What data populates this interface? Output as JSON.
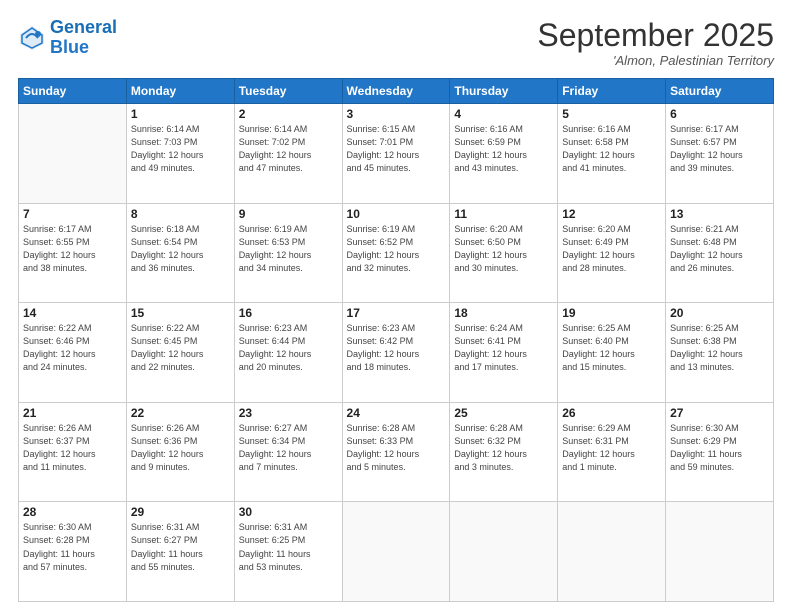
{
  "logo": {
    "line1": "General",
    "line2": "Blue"
  },
  "header": {
    "month": "September 2025",
    "location": "'Almon, Palestinian Territory"
  },
  "weekdays": [
    "Sunday",
    "Monday",
    "Tuesday",
    "Wednesday",
    "Thursday",
    "Friday",
    "Saturday"
  ],
  "weeks": [
    [
      {
        "day": "",
        "info": ""
      },
      {
        "day": "1",
        "info": "Sunrise: 6:14 AM\nSunset: 7:03 PM\nDaylight: 12 hours\nand 49 minutes."
      },
      {
        "day": "2",
        "info": "Sunrise: 6:14 AM\nSunset: 7:02 PM\nDaylight: 12 hours\nand 47 minutes."
      },
      {
        "day": "3",
        "info": "Sunrise: 6:15 AM\nSunset: 7:01 PM\nDaylight: 12 hours\nand 45 minutes."
      },
      {
        "day": "4",
        "info": "Sunrise: 6:16 AM\nSunset: 6:59 PM\nDaylight: 12 hours\nand 43 minutes."
      },
      {
        "day": "5",
        "info": "Sunrise: 6:16 AM\nSunset: 6:58 PM\nDaylight: 12 hours\nand 41 minutes."
      },
      {
        "day": "6",
        "info": "Sunrise: 6:17 AM\nSunset: 6:57 PM\nDaylight: 12 hours\nand 39 minutes."
      }
    ],
    [
      {
        "day": "7",
        "info": "Sunrise: 6:17 AM\nSunset: 6:55 PM\nDaylight: 12 hours\nand 38 minutes."
      },
      {
        "day": "8",
        "info": "Sunrise: 6:18 AM\nSunset: 6:54 PM\nDaylight: 12 hours\nand 36 minutes."
      },
      {
        "day": "9",
        "info": "Sunrise: 6:19 AM\nSunset: 6:53 PM\nDaylight: 12 hours\nand 34 minutes."
      },
      {
        "day": "10",
        "info": "Sunrise: 6:19 AM\nSunset: 6:52 PM\nDaylight: 12 hours\nand 32 minutes."
      },
      {
        "day": "11",
        "info": "Sunrise: 6:20 AM\nSunset: 6:50 PM\nDaylight: 12 hours\nand 30 minutes."
      },
      {
        "day": "12",
        "info": "Sunrise: 6:20 AM\nSunset: 6:49 PM\nDaylight: 12 hours\nand 28 minutes."
      },
      {
        "day": "13",
        "info": "Sunrise: 6:21 AM\nSunset: 6:48 PM\nDaylight: 12 hours\nand 26 minutes."
      }
    ],
    [
      {
        "day": "14",
        "info": "Sunrise: 6:22 AM\nSunset: 6:46 PM\nDaylight: 12 hours\nand 24 minutes."
      },
      {
        "day": "15",
        "info": "Sunrise: 6:22 AM\nSunset: 6:45 PM\nDaylight: 12 hours\nand 22 minutes."
      },
      {
        "day": "16",
        "info": "Sunrise: 6:23 AM\nSunset: 6:44 PM\nDaylight: 12 hours\nand 20 minutes."
      },
      {
        "day": "17",
        "info": "Sunrise: 6:23 AM\nSunset: 6:42 PM\nDaylight: 12 hours\nand 18 minutes."
      },
      {
        "day": "18",
        "info": "Sunrise: 6:24 AM\nSunset: 6:41 PM\nDaylight: 12 hours\nand 17 minutes."
      },
      {
        "day": "19",
        "info": "Sunrise: 6:25 AM\nSunset: 6:40 PM\nDaylight: 12 hours\nand 15 minutes."
      },
      {
        "day": "20",
        "info": "Sunrise: 6:25 AM\nSunset: 6:38 PM\nDaylight: 12 hours\nand 13 minutes."
      }
    ],
    [
      {
        "day": "21",
        "info": "Sunrise: 6:26 AM\nSunset: 6:37 PM\nDaylight: 12 hours\nand 11 minutes."
      },
      {
        "day": "22",
        "info": "Sunrise: 6:26 AM\nSunset: 6:36 PM\nDaylight: 12 hours\nand 9 minutes."
      },
      {
        "day": "23",
        "info": "Sunrise: 6:27 AM\nSunset: 6:34 PM\nDaylight: 12 hours\nand 7 minutes."
      },
      {
        "day": "24",
        "info": "Sunrise: 6:28 AM\nSunset: 6:33 PM\nDaylight: 12 hours\nand 5 minutes."
      },
      {
        "day": "25",
        "info": "Sunrise: 6:28 AM\nSunset: 6:32 PM\nDaylight: 12 hours\nand 3 minutes."
      },
      {
        "day": "26",
        "info": "Sunrise: 6:29 AM\nSunset: 6:31 PM\nDaylight: 12 hours\nand 1 minute."
      },
      {
        "day": "27",
        "info": "Sunrise: 6:30 AM\nSunset: 6:29 PM\nDaylight: 11 hours\nand 59 minutes."
      }
    ],
    [
      {
        "day": "28",
        "info": "Sunrise: 6:30 AM\nSunset: 6:28 PM\nDaylight: 11 hours\nand 57 minutes."
      },
      {
        "day": "29",
        "info": "Sunrise: 6:31 AM\nSunset: 6:27 PM\nDaylight: 11 hours\nand 55 minutes."
      },
      {
        "day": "30",
        "info": "Sunrise: 6:31 AM\nSunset: 6:25 PM\nDaylight: 11 hours\nand 53 minutes."
      },
      {
        "day": "",
        "info": ""
      },
      {
        "day": "",
        "info": ""
      },
      {
        "day": "",
        "info": ""
      },
      {
        "day": "",
        "info": ""
      }
    ]
  ]
}
